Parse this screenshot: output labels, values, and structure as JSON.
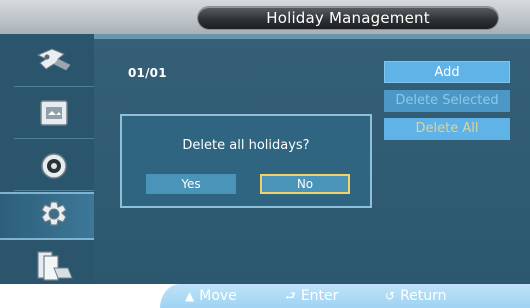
{
  "header": {
    "title": "Holiday Management"
  },
  "sidebar": {
    "items": [
      {
        "icon": "signal-tool-icon"
      },
      {
        "icon": "picture-icon"
      },
      {
        "icon": "sound-icon"
      },
      {
        "icon": "gear-icon",
        "active": true
      },
      {
        "icon": "multi-screen-icon"
      }
    ]
  },
  "content": {
    "page_counter": "01/01",
    "buttons": {
      "add": "Add",
      "delete_selected": "Delete Selected",
      "delete_all": "Delete All"
    }
  },
  "dialog": {
    "message": "Delete all holidays?",
    "yes_label": "Yes",
    "no_label": "No"
  },
  "footer": {
    "move_label": "Move",
    "enter_label": "Enter",
    "return_label": "Return",
    "move_icon": "up-down-icon",
    "enter_icon": "enter-icon",
    "return_icon": "return-icon"
  },
  "colors": {
    "panel": "#2f5c74",
    "button": "#5fb3e6",
    "focus_border": "#f2d264",
    "footer": "#9fd3f2"
  }
}
